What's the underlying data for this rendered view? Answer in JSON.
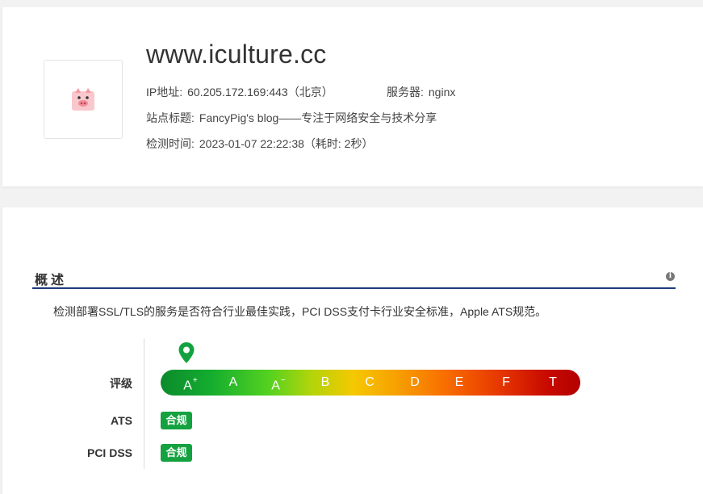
{
  "site": {
    "domain": "www.iculture.cc",
    "ip_label": "IP地址:",
    "ip_value": "60.205.172.169:443（北京）",
    "server_label": "服务器:",
    "server_value": "nginx",
    "title_label": "站点标题:",
    "title_value": "FancyPig's blog——专注于网络安全与技术分享",
    "time_label": "检测时间:",
    "time_value": "2023-01-07 22:22:38（耗时: 2秒）",
    "logo_icon": "pig-icon"
  },
  "overview": {
    "title": "概述",
    "description": "检测部署SSL/TLS的服务是否符合行业最佳实践，PCI DSS支付卡行业安全标准，Apple ATS规范。",
    "info_icon": "info-icon",
    "grade_label": "评级",
    "grades": [
      {
        "base": "A",
        "mod": "+"
      },
      {
        "base": "A",
        "mod": ""
      },
      {
        "base": "A",
        "mod": "−"
      },
      {
        "base": "B",
        "mod": ""
      },
      {
        "base": "C",
        "mod": ""
      },
      {
        "base": "D",
        "mod": ""
      },
      {
        "base": "E",
        "mod": ""
      },
      {
        "base": "F",
        "mod": ""
      },
      {
        "base": "T",
        "mod": ""
      }
    ],
    "current_grade": "A+",
    "ats_label": "ATS",
    "ats_status": "合规",
    "pci_label": "PCI DSS",
    "pci_status": "合规",
    "colors": {
      "compliant": "#13a23f",
      "section_rule": "#1f3a7a",
      "marker": "#13a23f"
    }
  }
}
